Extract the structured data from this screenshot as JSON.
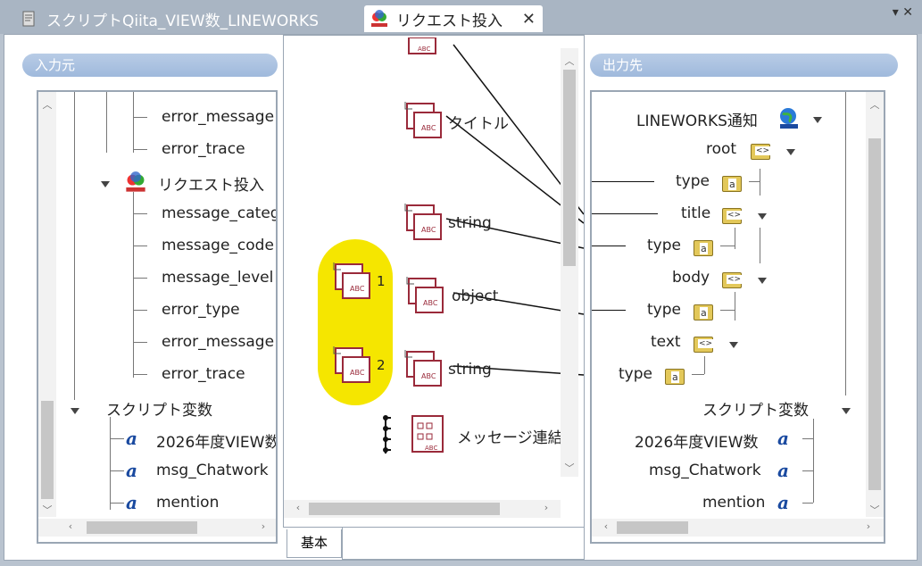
{
  "tabs": {
    "inactive_label": "スクリプトQiita_VIEW数_LINEWORKS",
    "active_label": "リクエスト投入",
    "close": "✕",
    "menu": "▾ ✕"
  },
  "left": {
    "header": "入力元",
    "items": {
      "error_message_1": "error_message",
      "error_trace_1": "error_trace",
      "request_node": "リクエスト投入",
      "message_category": "message_category",
      "message_code": "message_code",
      "message_level": "message_level",
      "error_type": "error_type",
      "error_message_2": "error_message",
      "error_trace_2": "error_trace",
      "script_vars": "スクリプト変数",
      "var1": "2026年度VIEW数",
      "var2": "msg_Chatwork",
      "var3": "mention"
    }
  },
  "middle": {
    "title_label": "タイトル",
    "string1_label": "string",
    "object_label": "object",
    "string2_label": "string",
    "num1": "1",
    "num2": "2",
    "concat_label": "メッセージ連結",
    "basic_tab": "基本"
  },
  "right": {
    "header": "出力先",
    "items": {
      "lineworks": "LINEWORKS通知",
      "root": "root",
      "type1": "type",
      "title": "title",
      "type2": "type",
      "body": "body",
      "type3": "type",
      "text": "text",
      "type4": "type",
      "script_vars": "スクリプト変数",
      "var1": "2026年度VIEW数",
      "var2": "msg_Chatwork",
      "var3": "mention"
    }
  },
  "colors": {
    "accent": "#9fb9dc",
    "highlight": "#f5e600",
    "icon_red": "#9a2a3a"
  }
}
